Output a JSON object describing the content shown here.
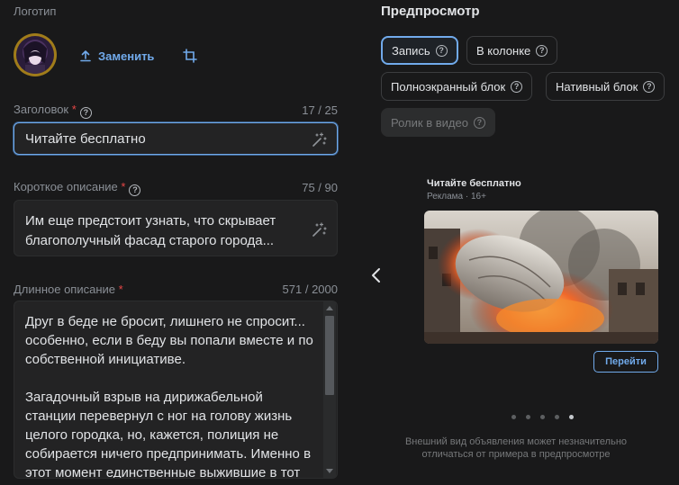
{
  "logo": {
    "label": "Логотип",
    "replace_label": "Заменить"
  },
  "title_field": {
    "label": "Заголовок",
    "required_mark": "*",
    "counter": "17 / 25",
    "value": "Читайте бесплатно"
  },
  "short_desc": {
    "label": "Короткое описание",
    "required_mark": "*",
    "counter": "75 / 90",
    "value_line1": "Им еще предстоит узнать, что скрывает",
    "value_line2": "благополучный фасад старого города..."
  },
  "long_desc": {
    "label": "Длинное описание",
    "required_mark": "*",
    "counter": "571 / 2000",
    "lines": [
      "Друг в беде не бросит, лишнего не спросит...",
      "особенно, если в беду вы попали вместе и по",
      "собственной инициативе.",
      "",
      "Загадочный взрыв на дирижабельной",
      "станции перевернул с ног на голову жизнь",
      "целого городка, но, кажется, полиция не",
      "собирается ничего предпринимать. Именно в",
      "этот момент единственные выжившие в тот"
    ]
  },
  "preview": {
    "heading": "Предпросмотр",
    "formats": [
      {
        "label": "Запись",
        "state": "active"
      },
      {
        "label": "В колонке",
        "state": "normal"
      },
      {
        "label": "Полноэкранный блок",
        "state": "normal"
      },
      {
        "label": "Нативный блок",
        "state": "normal"
      },
      {
        "label": "Ролик в видео",
        "state": "disabled"
      }
    ],
    "ad_title": "Читайте бесплатно",
    "ad_meta": "Реклама · 16+",
    "cta": "Перейти",
    "carousel_total": 5,
    "carousel_active": 5,
    "disclaimer_line1": "Внешний вид объявления может незначительно",
    "disclaimer_line2": "отличаться от примера в предпросмотре"
  },
  "colors": {
    "accent": "#71aaeb",
    "background": "#19191a",
    "field": "#232324",
    "required": "#e64646"
  }
}
